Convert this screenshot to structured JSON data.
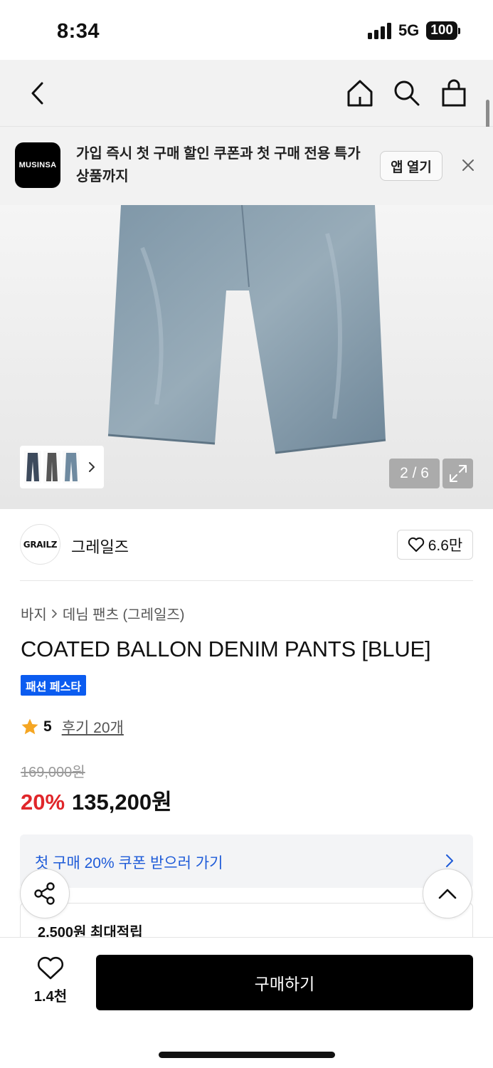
{
  "status_bar": {
    "time": "8:34",
    "network": "5G",
    "battery": "100"
  },
  "app_banner": {
    "logo_text": "MUSINSA",
    "message": "가입 즉시 첫 구매 할인 쿠폰과 첫 구매 전용 특가 상품까지",
    "open_label": "앱 열기"
  },
  "gallery": {
    "counter": "2 / 6"
  },
  "brand": {
    "logo_text": "GRAILZ",
    "name": "그레일즈",
    "likes": "6.6만"
  },
  "breadcrumb": {
    "level1": "바지",
    "level2": "데님 팬츠 (그레일즈)"
  },
  "product": {
    "title": "COATED BALLON DENIM PANTS [BLUE]",
    "badge": "패션 페스타",
    "rating": "5",
    "reviews": "후기 20개",
    "original_price": "169,000원",
    "discount": "20%",
    "price": "135,200원"
  },
  "coupon": {
    "text": "첫 구매 20% 쿠폰 받으러 가기"
  },
  "points": {
    "text": "2,500원 최대적립"
  },
  "bottom": {
    "wish_count": "1.4천",
    "buy_label": "구매하기"
  },
  "colors": {
    "accent_blue": "#1e5bd8",
    "badge_blue": "#0b5cf0",
    "discount_red": "#e0262a",
    "star": "#f5a623"
  }
}
